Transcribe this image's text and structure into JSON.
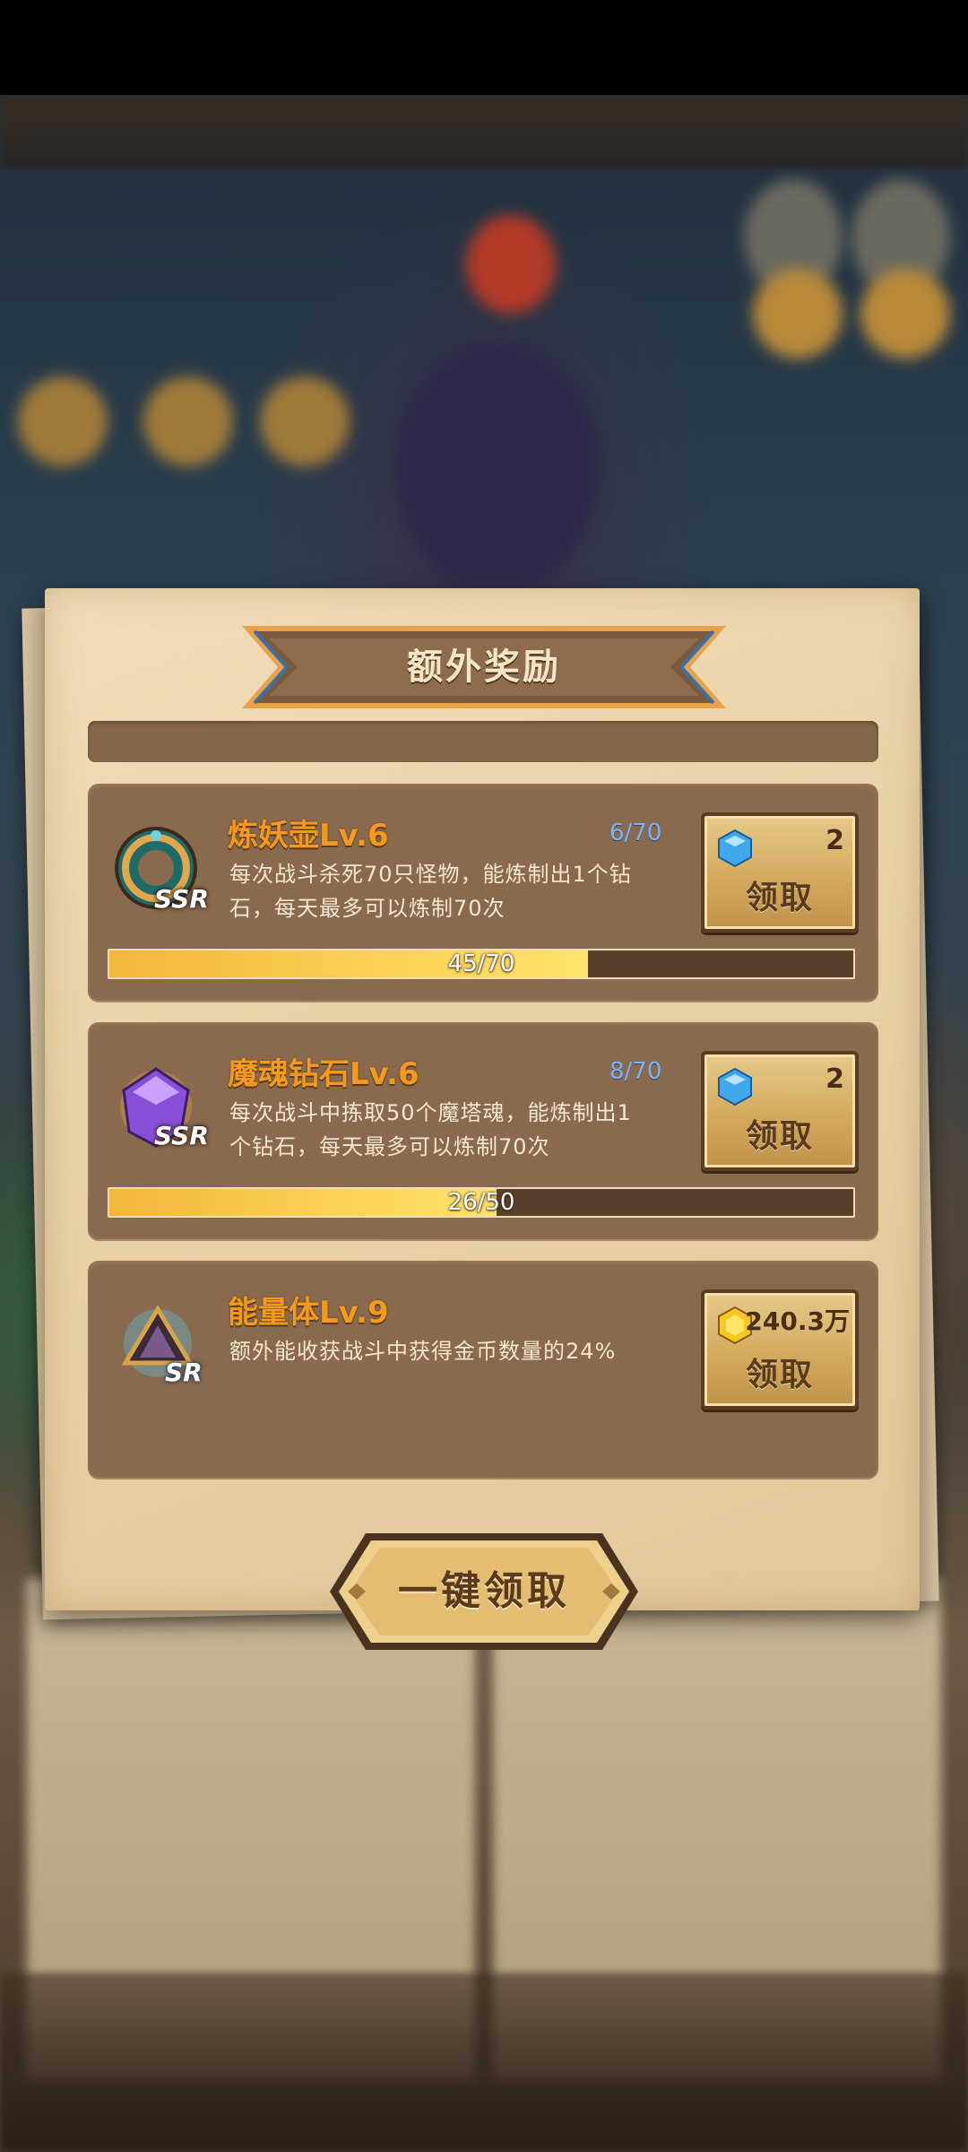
{
  "dialog": {
    "title": "额外奖励",
    "claim_all_label": "一键领取"
  },
  "rewards": [
    {
      "name": "炼妖壶Lv.6",
      "rarity": "SSR",
      "count": "6/70",
      "description_line1": "每次战斗杀死70只怪物，能炼制出1个钻",
      "description_line2": "石，每天最多可以炼制70次",
      "progress_text": "45/70",
      "progress_fraction": 0.6429,
      "reward_icon": "diamond-icon",
      "reward_amount": "2",
      "claim_label": "领取"
    },
    {
      "name": "魔魂钻石Lv.6",
      "rarity": "SSR",
      "count": "8/70",
      "description_line1": "每次战斗中拣取50个魔塔魂，能炼制出1",
      "description_line2": "个钻石，每天最多可以炼制70次",
      "progress_text": "26/50",
      "progress_fraction": 0.52,
      "reward_icon": "diamond-icon",
      "reward_amount": "2",
      "claim_label": "领取"
    },
    {
      "name": "能量体Lv.9",
      "rarity": "SR",
      "description_line1": "额外能收获战斗中获得金币数量的24%",
      "reward_icon": "gold-coin-icon",
      "reward_amount": "240.3万",
      "claim_label": "领取"
    }
  ],
  "colors": {
    "title_orange": "#f39a1e",
    "card_brown": "#8a6a4e",
    "count_blue": "#7fb2f0",
    "progress_gold": "#ffe46b"
  }
}
